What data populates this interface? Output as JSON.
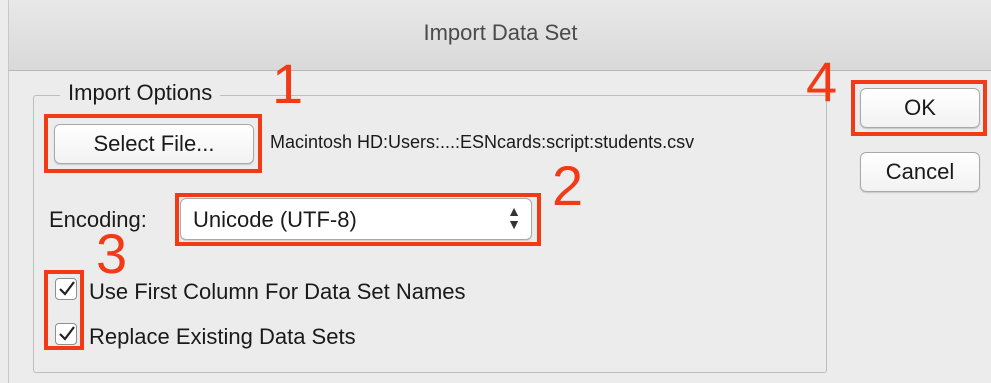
{
  "window": {
    "title": "Import Data Set"
  },
  "import_options": {
    "legend": "Import Options",
    "select_file_label": "Select File...",
    "file_path": "Macintosh HD:Users:...:ESNcards:script:students.csv",
    "encoding_label": "Encoding:",
    "encoding_value": "Unicode (UTF-8)",
    "checkboxes": [
      {
        "label": "Use First Column For Data Set Names",
        "checked": true
      },
      {
        "label": "Replace Existing Data Sets",
        "checked": true
      }
    ]
  },
  "buttons": {
    "ok_label": "OK",
    "cancel_label": "Cancel"
  },
  "annotations": {
    "colors": {
      "highlight": "#f23a16"
    },
    "steps": [
      "1",
      "2",
      "3",
      "4"
    ]
  }
}
